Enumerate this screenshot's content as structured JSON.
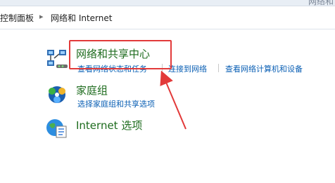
{
  "window": {
    "title_fragment": "网络和"
  },
  "breadcrumb": {
    "items": [
      "控制面板",
      "网络和 Internet"
    ],
    "separator": "▸"
  },
  "categories": [
    {
      "title": "网络和共享中心",
      "icon": "network-sharing-icon",
      "links": [
        "查看网络状态和任务",
        "连接到网络",
        "查看网络计算机和设备"
      ]
    },
    {
      "title": "家庭组",
      "icon": "homegroup-icon",
      "links": [
        "选择家庭组和共享选项"
      ]
    },
    {
      "title": "Internet 选项",
      "icon": "internet-options-icon",
      "links": []
    }
  ],
  "colors": {
    "title_green": "#1d6b1d",
    "link_blue": "#0a5fb4",
    "annotation_red": "#e23a3a"
  }
}
